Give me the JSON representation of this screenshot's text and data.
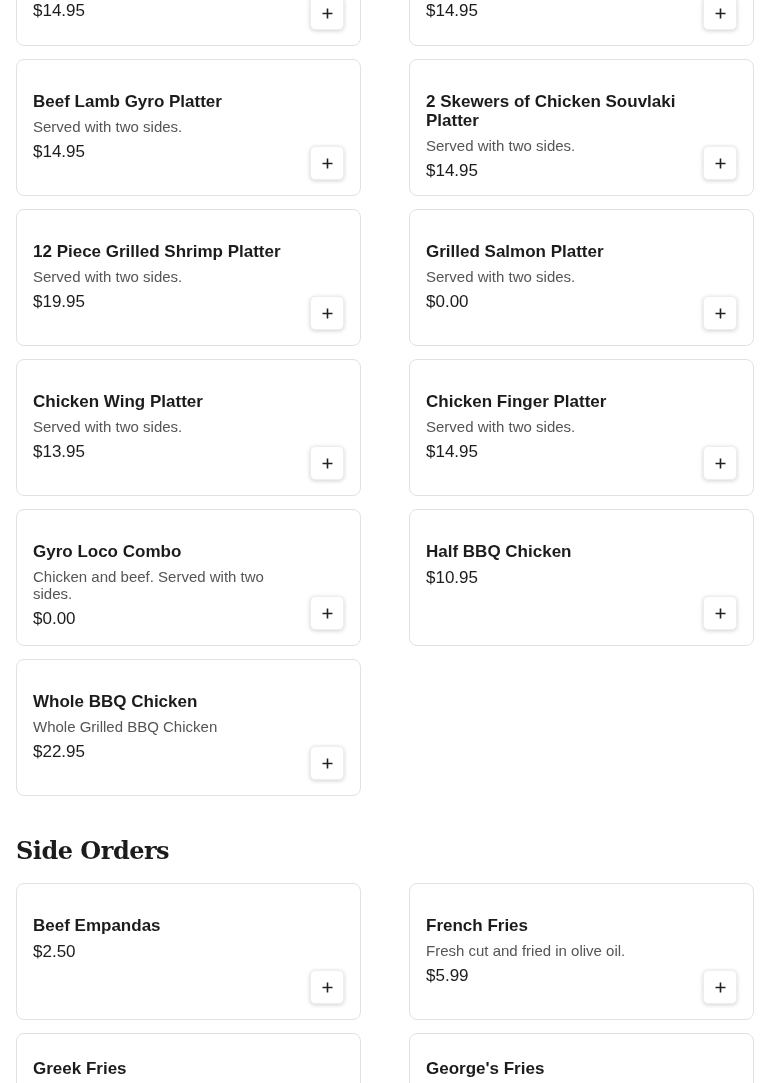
{
  "sections": [
    {
      "items": [
        {
          "price": "$14.95"
        },
        {
          "price": "$14.95"
        },
        {
          "name": "Beef Lamb Gyro Platter",
          "description": "Served with two sides.",
          "price": "$14.95"
        },
        {
          "name": "2 Skewers of Chicken Souvlaki Platter",
          "description": "Served with two sides.",
          "price": "$14.95"
        },
        {
          "name": "12 Piece Grilled Shrimp Platter",
          "description": "Served with two sides.",
          "price": "$19.95"
        },
        {
          "name": "Grilled Salmon Platter",
          "description": "Served with two sides.",
          "price": "$0.00"
        },
        {
          "name": "Chicken Wing Platter",
          "description": "Served with two sides.",
          "price": "$13.95"
        },
        {
          "name": "Chicken Finger Platter",
          "description": "Served with two sides.",
          "price": "$14.95"
        },
        {
          "name": "Gyro Loco Combo",
          "description": "Chicken and beef. Served with two sides.",
          "price": "$0.00"
        },
        {
          "name": "Half BBQ Chicken",
          "price": "$10.95"
        },
        {
          "name": "Whole BBQ Chicken",
          "description": "Whole Grilled BBQ Chicken",
          "price": "$22.95"
        }
      ]
    },
    {
      "title": "Side Orders",
      "items": [
        {
          "name": "Beef Empandas",
          "price": "$2.50"
        },
        {
          "name": "French Fries",
          "description": "Fresh cut and fried in olive oil.",
          "price": "$5.99"
        },
        {
          "name": "Greek Fries"
        },
        {
          "name": "George's Fries"
        }
      ]
    }
  ]
}
